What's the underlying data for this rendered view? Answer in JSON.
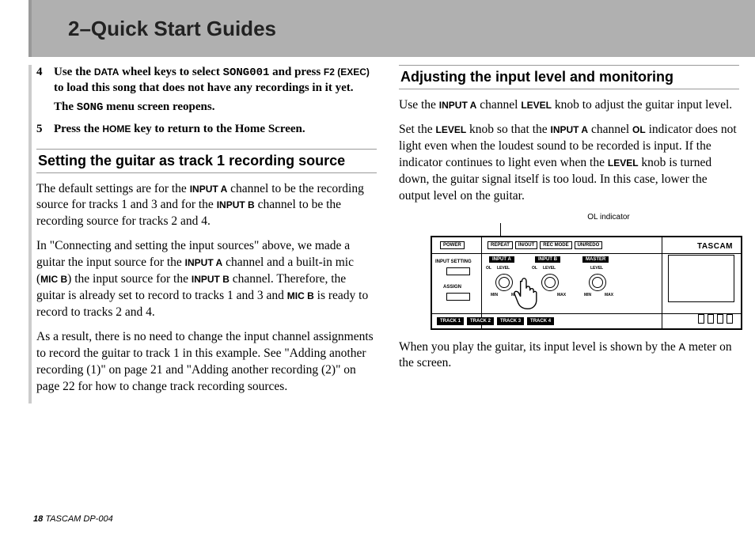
{
  "header": {
    "title": "2–Quick Start Guides"
  },
  "left": {
    "step4": {
      "num": "4",
      "pre": "Use the ",
      "data": "DATA",
      "mid1": " wheel keys to select ",
      "song001": "SONG001",
      "mid2": " and press ",
      "f2": "F2 (EXEC)",
      "post": " to load this song that does not have any recordings in it yet."
    },
    "step4_sub_pre": "The ",
    "step4_sub_mono": "SONG",
    "step4_sub_post": " menu screen reopens.",
    "step5": {
      "num": "5",
      "pre": "Press the ",
      "home": "HOME",
      "post": " key to return to the Home Screen."
    },
    "heading1": "Setting the guitar as track 1 recording source",
    "p1_pre": "The default settings are for the ",
    "p1_ia": "INPUT A",
    "p1_mid": " channel to be the recording source for tracks 1 and 3 and for the ",
    "p1_ib": "INPUT B",
    "p1_post": " channel to be the recording source for tracks 2 and 4.",
    "p2_a": "In \"Connecting and setting the input sources\" above, we made a guitar the input source for the ",
    "p2_ia": "INPUT A",
    "p2_b": " channel and a built-in mic (",
    "p2_micb1": "MIC B",
    "p2_c": ") the input source for the ",
    "p2_ib": "INPUT B",
    "p2_d": " channel. Therefore, the guitar is already set to record to tracks 1 and 3 and ",
    "p2_micb2": "MIC B",
    "p2_e": " is ready to record to tracks 2 and 4.",
    "p3": "As a result, there is no need to change the input channel assignments to record the guitar to track 1 in this example. See \"Adding another recording (1)\" on page 21 and  \"Adding another recording (2)\" on page 22 for how to change track recording sources."
  },
  "right": {
    "heading2": "Adjusting the input level and monitoring",
    "r1_a": "Use the ",
    "r1_ia": "INPUT A",
    "r1_b": " channel ",
    "r1_level": "LEVEL",
    "r1_c": " knob to adjust the guitar input level.",
    "r2_a": "Set the ",
    "r2_level1": "LEVEL",
    "r2_b": " knob so that the ",
    "r2_ia": "INPUT A",
    "r2_c": " channel ",
    "r2_ol": "OL",
    "r2_d": " indicator does not light even when the loudest sound to be recorded is input. If the indicator continues to light even when the ",
    "r2_level2": "LEVEL",
    "r2_e": " knob is turned down, the guitar signal itself is too loud. In this case, lower the output level on the guitar.",
    "diagram": {
      "ol_indicator": "OL indicator",
      "power": "POWER",
      "repeat": "REPEAT",
      "inout": "IN/OUT",
      "recmode": "REC MODE",
      "unredo": "UN/REDO",
      "brand": "TASCAM",
      "input_setting": "INPUT SETTING",
      "input_a": "INPUT A",
      "input_b": "INPUT B",
      "master": "MASTER",
      "assign": "ASSIGN",
      "level": "LEVEL",
      "ol": "OL",
      "min": "MIN",
      "max": "MAX",
      "track1": "TRACK 1",
      "track2": "TRACK 2",
      "track3": "TRACK 3",
      "track4": "TRACK 4"
    },
    "r3_a": "When you play the guitar, its input level is shown by the ",
    "r3_mono": "A",
    "r3_b": " meter on the screen."
  },
  "footer": {
    "page": "18",
    "model": "TASCAM  DP-004"
  }
}
